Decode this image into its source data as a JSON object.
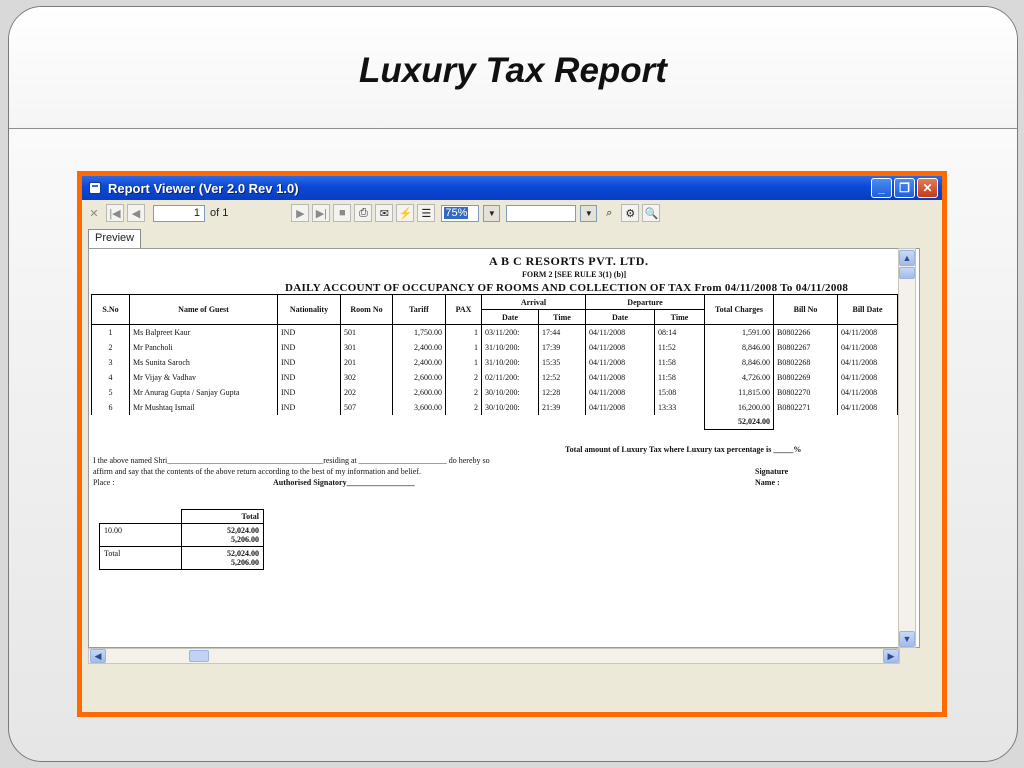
{
  "slide": {
    "title": "Luxury Tax Report"
  },
  "window": {
    "title": "Report Viewer (Ver 2.0 Rev 1.0)",
    "minimize": "_",
    "restore": "❐",
    "close": "✕"
  },
  "toolbar": {
    "page_value": "1",
    "page_of": "of 1",
    "zoom_value": "75%"
  },
  "tab": {
    "label": "Preview"
  },
  "report": {
    "company": "A B C RESORTS PVT. LTD.",
    "form": "FORM 2 [SEE RULE 3(1) (b)]",
    "heading": "DAILY ACCOUNT OF OCCUPANCY OF ROOMS AND COLLECTION OF TAX From 04/11/2008 To 04/11/2008",
    "columns": {
      "sno": "S.No",
      "guest": "Name of Guest",
      "nationality": "Nationality",
      "room": "Room No",
      "tariff": "Tariff",
      "pax": "PAX",
      "arrival": "Arrival",
      "departure": "Departure",
      "date": "Date",
      "time": "Time",
      "total": "Total Charges",
      "bill_no": "Bill No",
      "bill_date": "Bill Date"
    },
    "rows": [
      {
        "sno": "1",
        "guest": "Ms Balpreet Kaur",
        "nat": "IND",
        "room": "501",
        "tariff": "1,750.00",
        "pax": "1",
        "arr_date": "03/11/200:",
        "arr_time": "17:44",
        "dep_date": "04/11/2008",
        "dep_time": "08:14",
        "total": "1,591.00",
        "bill_no": "B0802266",
        "bill_date": "04/11/2008"
      },
      {
        "sno": "2",
        "guest": "Mr Pancholi",
        "nat": "IND",
        "room": "301",
        "tariff": "2,400.00",
        "pax": "1",
        "arr_date": "31/10/200:",
        "arr_time": "17:39",
        "dep_date": "04/11/2008",
        "dep_time": "11:52",
        "total": "8,846.00",
        "bill_no": "B0802267",
        "bill_date": "04/11/2008"
      },
      {
        "sno": "3",
        "guest": "Ms Sunita Saroch",
        "nat": "IND",
        "room": "201",
        "tariff": "2,400.00",
        "pax": "1",
        "arr_date": "31/10/200:",
        "arr_time": "15:35",
        "dep_date": "04/11/2008",
        "dep_time": "11:58",
        "total": "8,846.00",
        "bill_no": "B0802268",
        "bill_date": "04/11/2008"
      },
      {
        "sno": "4",
        "guest": "Mr Vijay & Vadhav",
        "nat": "IND",
        "room": "302",
        "tariff": "2,600.00",
        "pax": "2",
        "arr_date": "02/11/200:",
        "arr_time": "12:52",
        "dep_date": "04/11/2008",
        "dep_time": "11:58",
        "total": "4,726.00",
        "bill_no": "B0802269",
        "bill_date": "04/11/2008"
      },
      {
        "sno": "5",
        "guest": "Mr Anurag Gupta / Sanjay Gupta",
        "nat": "IND",
        "room": "202",
        "tariff": "2,600.00",
        "pax": "2",
        "arr_date": "30/10/200:",
        "arr_time": "12:28",
        "dep_date": "04/11/2008",
        "dep_time": "15:08",
        "total": "11,815.00",
        "bill_no": "B0802270",
        "bill_date": "04/11/2008"
      },
      {
        "sno": "6",
        "guest": "Mr Mushtaq Ismail",
        "nat": "IND",
        "room": "507",
        "tariff": "3,600.00",
        "pax": "2",
        "arr_date": "30/10/200:",
        "arr_time": "21:39",
        "dep_date": "04/11/2008",
        "dep_time": "13:33",
        "total": "16,200.00",
        "bill_no": "B0802271",
        "bill_date": "04/11/2008"
      }
    ],
    "grand_total": "52,024.00",
    "footer": {
      "lux_tax": "Total amount of Luxury Tax where Luxury tax percentage is _____%",
      "line1a": "I the above named Shri_______________________________________residing at ______________________ do hereby so",
      "line2": "affirm and say that the contents of the above return according to the best of my information and belief.",
      "signature": "Signature",
      "place": "Place :",
      "authorised": "Authorised Signatory_________________",
      "name": "Name :"
    },
    "summary": {
      "header": "Total",
      "r1_label": "10.00",
      "r1_v1": "52,024.00",
      "r1_v2": "5,206.00",
      "r2_label": "Total",
      "r2_v1": "52,024.00",
      "r2_v2": "5,206.00"
    }
  }
}
